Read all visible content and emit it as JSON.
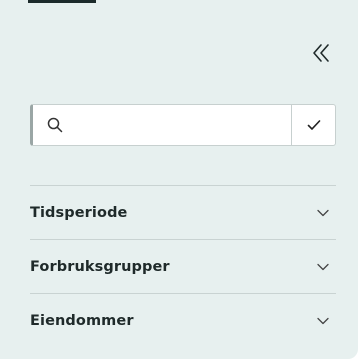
{
  "search": {
    "placeholder": "",
    "value": ""
  },
  "icons": {
    "collapse": "double-chevron-left-icon",
    "search": "search-icon",
    "confirm": "check-icon",
    "expand": "chevron-down-icon"
  },
  "filters": [
    {
      "label": "Tidsperiode"
    },
    {
      "label": "Forbruksgrupper"
    },
    {
      "label": "Eiendommer"
    }
  ],
  "colors": {
    "panel_background": "#e7f0ef",
    "active_tab": "#1c2b2b",
    "divider": "#c9d3d2"
  }
}
